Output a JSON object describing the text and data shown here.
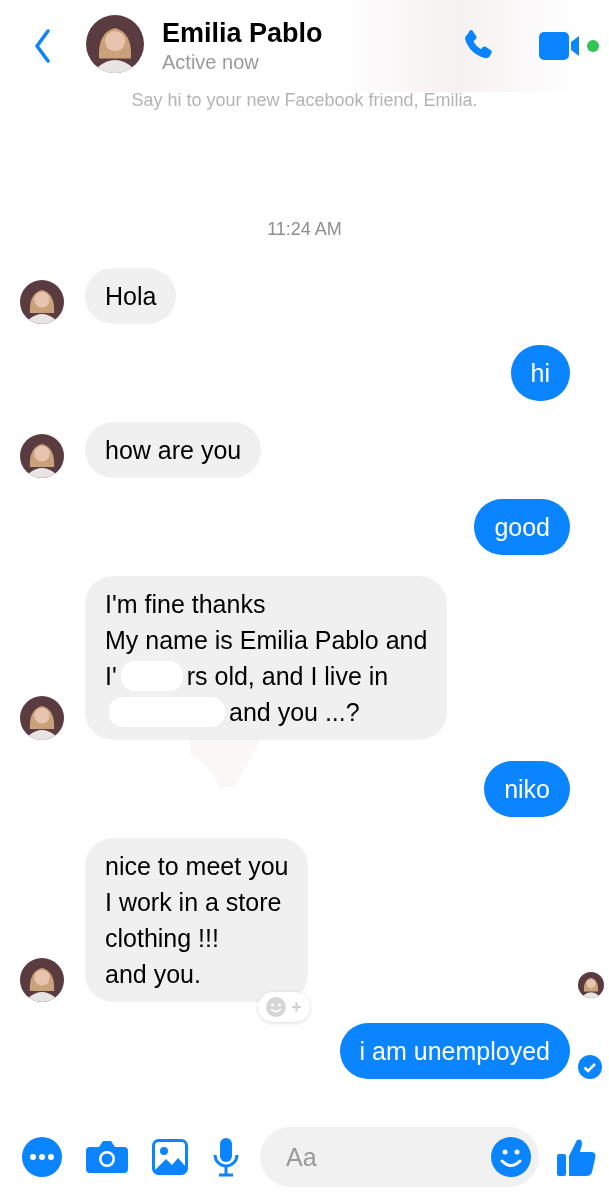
{
  "header": {
    "name": "Emilia Pablo",
    "status": "Active now",
    "online": true
  },
  "notice": "Say hi to your new Facebook friend, Emilia.",
  "timestamp": "11:24 AM",
  "messages": [
    {
      "kind": "incoming",
      "avatar": true,
      "lines": [
        {
          "parts": [
            "Hola"
          ]
        }
      ]
    },
    {
      "kind": "outgoing",
      "lines": [
        {
          "parts": [
            "hi"
          ]
        }
      ]
    },
    {
      "kind": "incoming",
      "avatar": true,
      "lines": [
        {
          "parts": [
            "how are you"
          ]
        }
      ]
    },
    {
      "kind": "outgoing",
      "lines": [
        {
          "parts": [
            "good"
          ]
        }
      ]
    },
    {
      "kind": "incoming",
      "avatar": true,
      "redacted": true,
      "lines": [
        {
          "parts": [
            "I'm fine thanks"
          ]
        },
        {
          "parts": [
            "My name is Emilia Pablo and"
          ]
        },
        {
          "parts": [
            "I'",
            "rs old, and I live in"
          ]
        },
        {
          "redacted_start": true,
          "parts": [
            "and you ...?"
          ]
        }
      ]
    },
    {
      "kind": "outgoing",
      "lines": [
        {
          "parts": [
            "niko"
          ]
        }
      ]
    },
    {
      "kind": "incoming",
      "avatar": true,
      "reaction_button": true,
      "seen_avatar": true,
      "lines": [
        {
          "parts": [
            "nice to meet you"
          ]
        },
        {
          "parts": [
            "I work in a store"
          ]
        },
        {
          "parts": [
            "clothing !!!"
          ]
        },
        {
          "parts": [
            "and you."
          ]
        }
      ]
    },
    {
      "kind": "outgoing",
      "delivered": true,
      "lines": [
        {
          "parts": [
            "i am unemployed"
          ]
        }
      ]
    }
  ],
  "composer": {
    "placeholder": "Aa"
  }
}
